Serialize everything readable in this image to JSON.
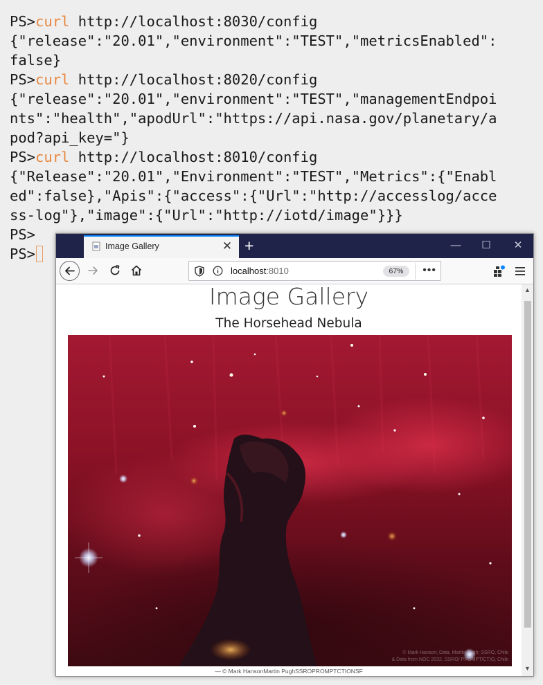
{
  "terminal": {
    "prompt": "PS>",
    "lines": [
      {
        "type": "cmd",
        "command": "curl",
        "args": " http://localhost:8030/config"
      },
      {
        "type": "out",
        "text": "{\"release\":\"20.01\",\"environment\":\"TEST\",\"metricsEnabled\":"
      },
      {
        "type": "out",
        "text": "false}"
      },
      {
        "type": "cmd",
        "command": "curl",
        "args": " http://localhost:8020/config"
      },
      {
        "type": "out",
        "text": "{\"release\":\"20.01\",\"environment\":\"TEST\",\"managementEndpoi"
      },
      {
        "type": "out",
        "text": "nts\":\"health\",\"apodUrl\":\"https://api.nasa.gov/planetary/a"
      },
      {
        "type": "out",
        "text": "pod?api_key=\"}"
      },
      {
        "type": "cmd",
        "command": "curl",
        "args": " http://localhost:8010/config"
      },
      {
        "type": "out",
        "text": "{\"Release\":\"20.01\",\"Environment\":\"TEST\",\"Metrics\":{\"Enabl"
      },
      {
        "type": "out",
        "text": "ed\":false},\"Apis\":{\"access\":{\"Url\":\"http://accesslog/acce"
      },
      {
        "type": "out",
        "text": "ss-log\"},\"image\":{\"Url\":\"http://iotd/image\"}}}"
      },
      {
        "type": "cmd",
        "command": "",
        "args": ""
      },
      {
        "type": "cursor"
      }
    ],
    "colors": {
      "background": "#eeeeee",
      "command": "#e8863e",
      "text": "#1a1a1a"
    }
  },
  "browser": {
    "tab": {
      "title": "Image Gallery",
      "icon": "page-icon",
      "close_icon": "close-icon"
    },
    "new_tab_label": "+",
    "window_buttons": {
      "minimize": "minimize-icon",
      "maximize": "maximize-icon",
      "close": "close-icon"
    },
    "address": {
      "host": "localhost",
      "port": ":8010",
      "zoom": "67%"
    },
    "toolbar_icons": [
      "back-icon",
      "forward-icon",
      "reload-icon",
      "home-icon",
      "shield-icon",
      "info-icon",
      "more-icon",
      "extensions-icon",
      "menu-icon"
    ],
    "colors": {
      "tabbar": "#1f2349",
      "accent": "#0a84ff"
    }
  },
  "page": {
    "title": "Image Gallery",
    "subtitle": "The Horsehead Nebula",
    "image_caption": "— © Mark HansonMartin PughSSROPROMPTCTIONSF",
    "watermark_line1": "© Mark Hanson; Data, Martin Pugh; SSRO, Chile",
    "watermark_line2": "& Data from NOC 2032, SSRO/ PROMPT/CTIO, Chile"
  }
}
